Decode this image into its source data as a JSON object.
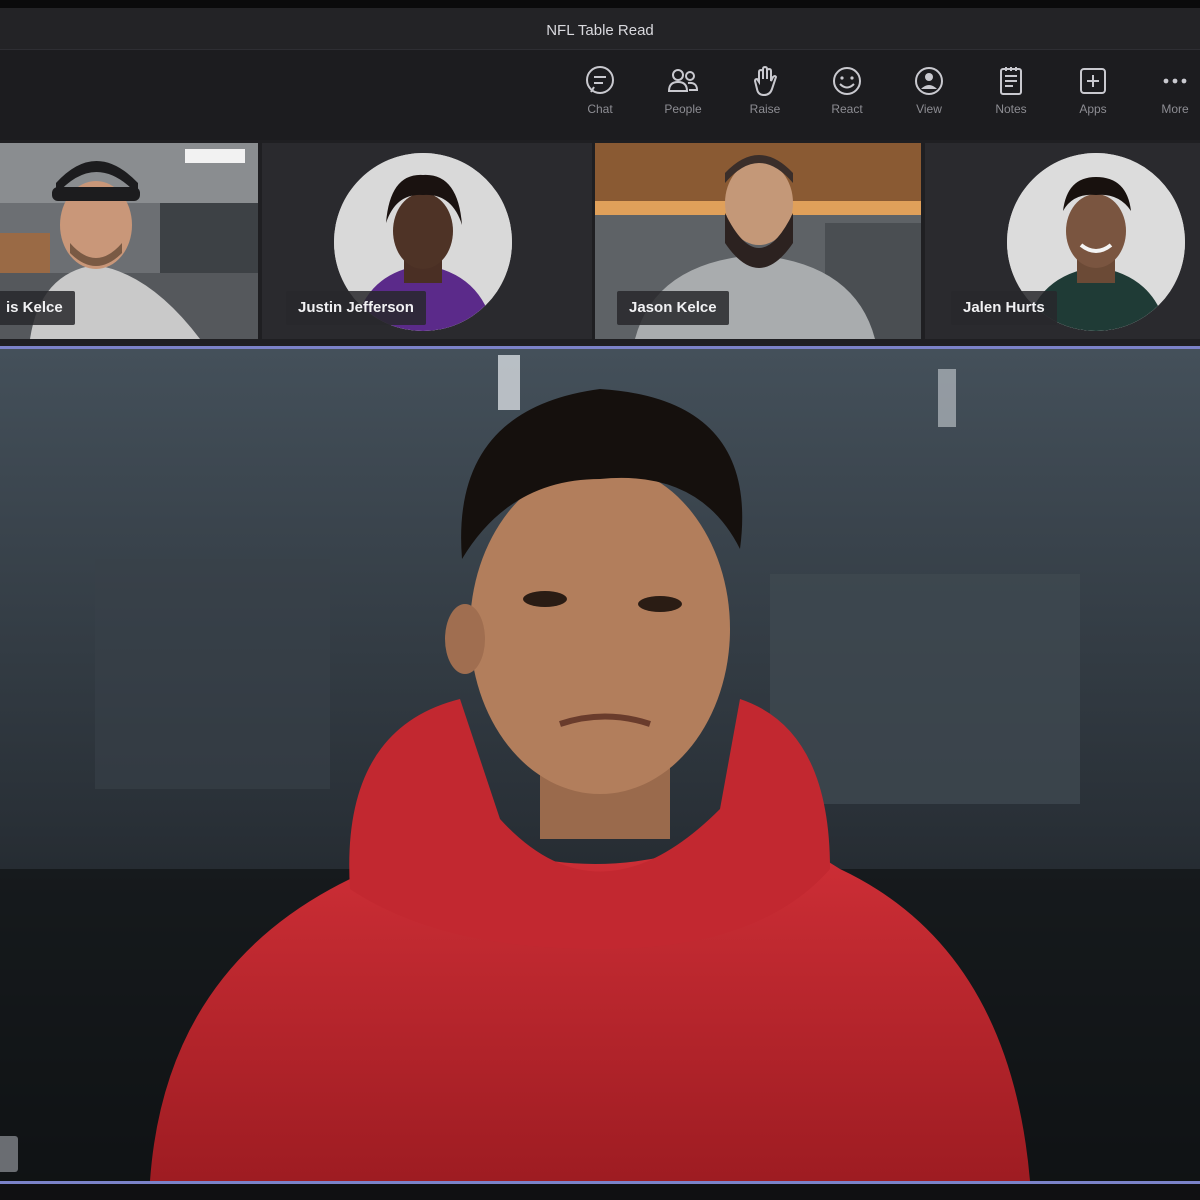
{
  "window": {
    "title": "NFL Table Read"
  },
  "toolbar": {
    "items": [
      {
        "label": "Chat",
        "icon": "chat-icon"
      },
      {
        "label": "People",
        "icon": "people-icon"
      },
      {
        "label": "Raise",
        "icon": "raise-hand-icon"
      },
      {
        "label": "React",
        "icon": "react-icon"
      },
      {
        "label": "View",
        "icon": "view-icon"
      },
      {
        "label": "Notes",
        "icon": "notes-icon"
      },
      {
        "label": "Apps",
        "icon": "apps-icon"
      },
      {
        "label": "More",
        "icon": "more-icon"
      }
    ]
  },
  "participants": [
    {
      "name": "is Kelce",
      "type": "video"
    },
    {
      "name": "Justin Jefferson",
      "type": "avatar"
    },
    {
      "name": "Jason Kelce",
      "type": "video"
    },
    {
      "name": "Jalen Hurts",
      "type": "avatar"
    }
  ],
  "colors": {
    "stage_border": "#7b82c8",
    "hoodie": "#c8282e"
  }
}
